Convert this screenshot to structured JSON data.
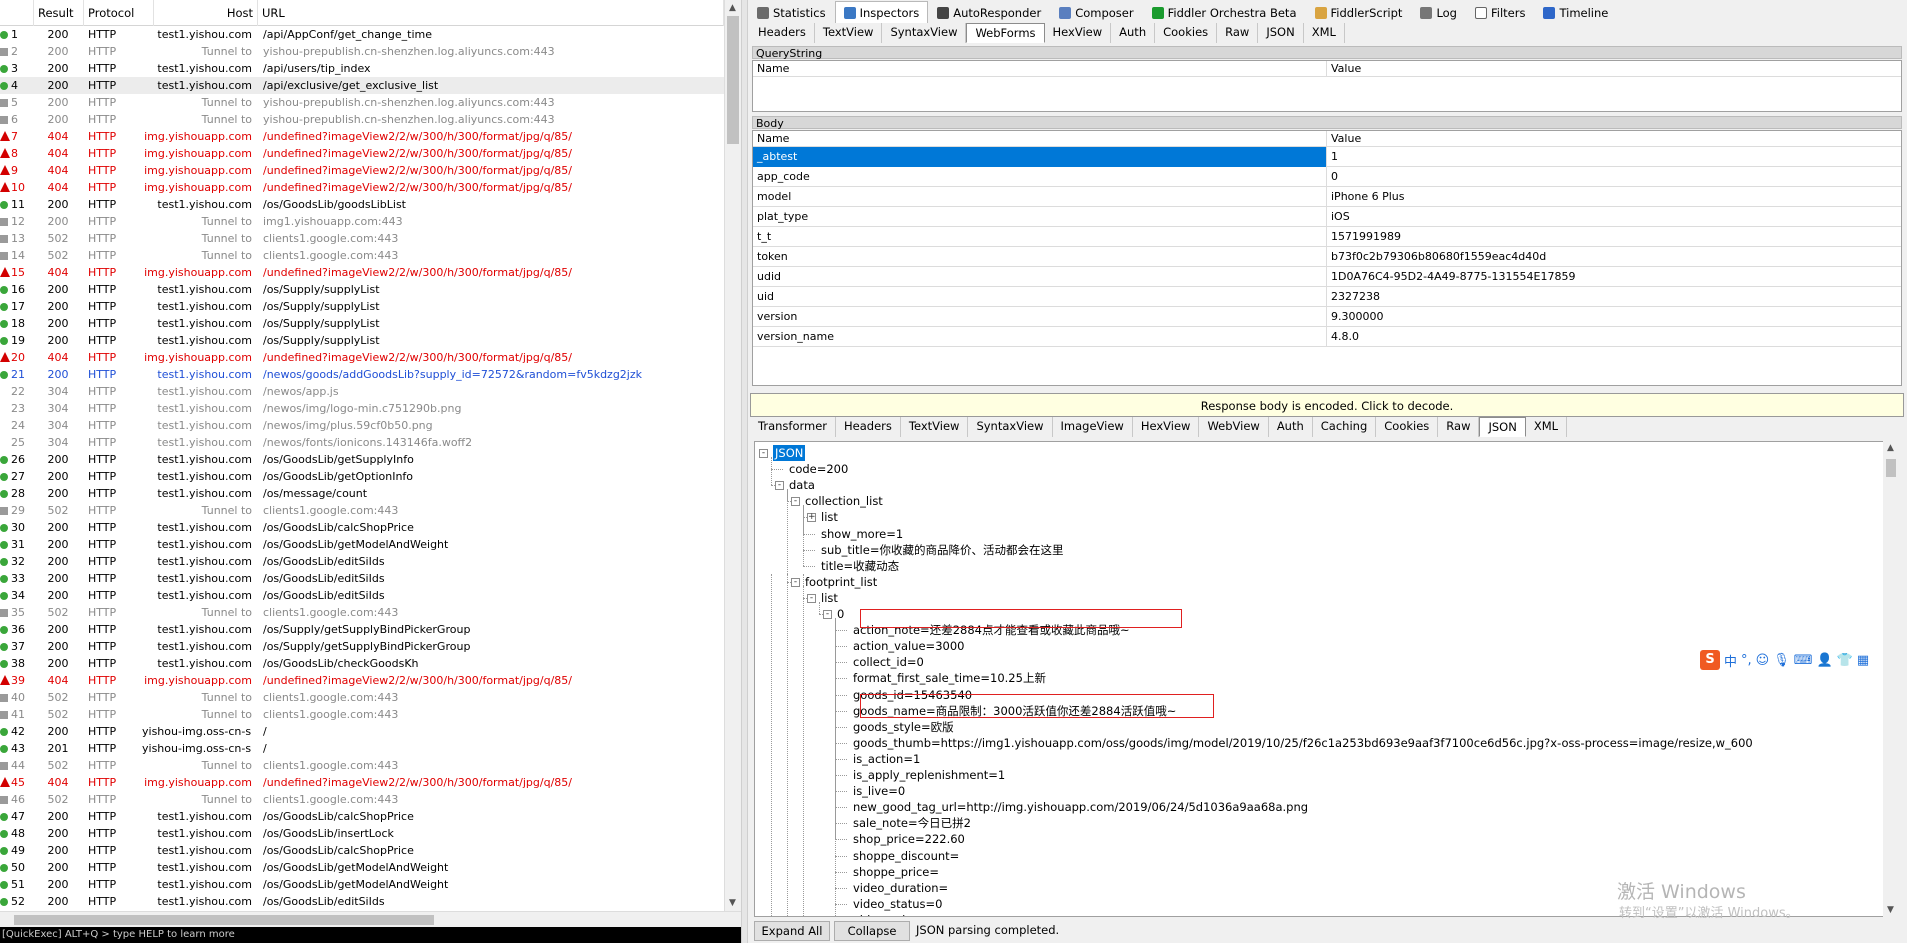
{
  "sessions": {
    "columns": [
      "Result",
      "Protocol",
      "Host",
      "URL"
    ],
    "rows": [
      {
        "num": "1",
        "result": "200",
        "protocol": "HTTP",
        "host": "test1.yishou.com",
        "url": "/api/AppConf/get_change_time",
        "style": "normal",
        "icon": "ok"
      },
      {
        "num": "2",
        "result": "200",
        "protocol": "HTTP",
        "host": "Tunnel to",
        "url": "yishou-prepublish.cn-shenzhen.log.aliyuncs.com:443",
        "style": "gray",
        "icon": "tun"
      },
      {
        "num": "3",
        "result": "200",
        "protocol": "HTTP",
        "host": "test1.yishou.com",
        "url": "/api/users/tip_index",
        "style": "normal",
        "icon": "ok"
      },
      {
        "num": "4",
        "result": "200",
        "protocol": "HTTP",
        "host": "test1.yishou.com",
        "url": "/api/exclusive/get_exclusive_list",
        "style": "normal",
        "icon": "ok",
        "selected": true
      },
      {
        "num": "5",
        "result": "200",
        "protocol": "HTTP",
        "host": "Tunnel to",
        "url": "yishou-prepublish.cn-shenzhen.log.aliyuncs.com:443",
        "style": "gray",
        "icon": "tun"
      },
      {
        "num": "6",
        "result": "200",
        "protocol": "HTTP",
        "host": "Tunnel to",
        "url": "yishou-prepublish.cn-shenzhen.log.aliyuncs.com:443",
        "style": "gray",
        "icon": "tun"
      },
      {
        "num": "7",
        "result": "404",
        "protocol": "HTTP",
        "host": "img.yishouapp.com",
        "url": "/undefined?imageView2/2/w/300/h/300/format/jpg/q/85/",
        "style": "err",
        "icon": "warn"
      },
      {
        "num": "8",
        "result": "404",
        "protocol": "HTTP",
        "host": "img.yishouapp.com",
        "url": "/undefined?imageView2/2/w/300/h/300/format/jpg/q/85/",
        "style": "err",
        "icon": "warn"
      },
      {
        "num": "9",
        "result": "404",
        "protocol": "HTTP",
        "host": "img.yishouapp.com",
        "url": "/undefined?imageView2/2/w/300/h/300/format/jpg/q/85/",
        "style": "err",
        "icon": "warn"
      },
      {
        "num": "10",
        "result": "404",
        "protocol": "HTTP",
        "host": "img.yishouapp.com",
        "url": "/undefined?imageView2/2/w/300/h/300/format/jpg/q/85/",
        "style": "err",
        "icon": "warn"
      },
      {
        "num": "11",
        "result": "200",
        "protocol": "HTTP",
        "host": "test1.yishou.com",
        "url": "/os/GoodsLib/goodsLibList",
        "style": "normal",
        "icon": "ok"
      },
      {
        "num": "12",
        "result": "200",
        "protocol": "HTTP",
        "host": "Tunnel to",
        "url": "img1.yishouapp.com:443",
        "style": "gray",
        "icon": "tun"
      },
      {
        "num": "13",
        "result": "502",
        "protocol": "HTTP",
        "host": "Tunnel to",
        "url": "clients1.google.com:443",
        "style": "gray",
        "icon": "tun"
      },
      {
        "num": "14",
        "result": "502",
        "protocol": "HTTP",
        "host": "Tunnel to",
        "url": "clients1.google.com:443",
        "style": "gray",
        "icon": "tun"
      },
      {
        "num": "15",
        "result": "404",
        "protocol": "HTTP",
        "host": "img.yishouapp.com",
        "url": "/undefined?imageView2/2/w/300/h/300/format/jpg/q/85/",
        "style": "err",
        "icon": "warn"
      },
      {
        "num": "16",
        "result": "200",
        "protocol": "HTTP",
        "host": "test1.yishou.com",
        "url": "/os/Supply/supplyList",
        "style": "normal",
        "icon": "ok"
      },
      {
        "num": "17",
        "result": "200",
        "protocol": "HTTP",
        "host": "test1.yishou.com",
        "url": "/os/Supply/supplyList",
        "style": "normal",
        "icon": "ok"
      },
      {
        "num": "18",
        "result": "200",
        "protocol": "HTTP",
        "host": "test1.yishou.com",
        "url": "/os/Supply/supplyList",
        "style": "normal",
        "icon": "ok"
      },
      {
        "num": "19",
        "result": "200",
        "protocol": "HTTP",
        "host": "test1.yishou.com",
        "url": "/os/Supply/supplyList",
        "style": "normal",
        "icon": "ok"
      },
      {
        "num": "20",
        "result": "404",
        "protocol": "HTTP",
        "host": "img.yishouapp.com",
        "url": "/undefined?imageView2/2/w/300/h/300/format/jpg/q/85/",
        "style": "err",
        "icon": "warn"
      },
      {
        "num": "21",
        "result": "200",
        "protocol": "HTTP",
        "host": "test1.yishou.com",
        "url": "/newos/goods/addGoodsLib?supply_id=72572&random=fv5kdzg2jzk",
        "style": "blue",
        "icon": "ok"
      },
      {
        "num": "22",
        "result": "304",
        "protocol": "HTTP",
        "host": "test1.yishou.com",
        "url": "/newos/app.js",
        "style": "gray",
        "icon": "none"
      },
      {
        "num": "23",
        "result": "304",
        "protocol": "HTTP",
        "host": "test1.yishou.com",
        "url": "/newos/img/logo-min.c751290b.png",
        "style": "gray",
        "icon": "none"
      },
      {
        "num": "24",
        "result": "304",
        "protocol": "HTTP",
        "host": "test1.yishou.com",
        "url": "/newos/img/plus.59cf0b50.png",
        "style": "gray",
        "icon": "none"
      },
      {
        "num": "25",
        "result": "304",
        "protocol": "HTTP",
        "host": "test1.yishou.com",
        "url": "/newos/fonts/ionicons.143146fa.woff2",
        "style": "gray",
        "icon": "none"
      },
      {
        "num": "26",
        "result": "200",
        "protocol": "HTTP",
        "host": "test1.yishou.com",
        "url": "/os/GoodsLib/getSupplyInfo",
        "style": "normal",
        "icon": "ok"
      },
      {
        "num": "27",
        "result": "200",
        "protocol": "HTTP",
        "host": "test1.yishou.com",
        "url": "/os/GoodsLib/getOptionInfo",
        "style": "normal",
        "icon": "ok"
      },
      {
        "num": "28",
        "result": "200",
        "protocol": "HTTP",
        "host": "test1.yishou.com",
        "url": "/os/message/count",
        "style": "normal",
        "icon": "ok"
      },
      {
        "num": "29",
        "result": "502",
        "protocol": "HTTP",
        "host": "Tunnel to",
        "url": "clients1.google.com:443",
        "style": "gray",
        "icon": "tun"
      },
      {
        "num": "30",
        "result": "200",
        "protocol": "HTTP",
        "host": "test1.yishou.com",
        "url": "/os/GoodsLib/calcShopPrice",
        "style": "normal",
        "icon": "ok"
      },
      {
        "num": "31",
        "result": "200",
        "protocol": "HTTP",
        "host": "test1.yishou.com",
        "url": "/os/GoodsLib/getModelAndWeight",
        "style": "normal",
        "icon": "ok"
      },
      {
        "num": "32",
        "result": "200",
        "protocol": "HTTP",
        "host": "test1.yishou.com",
        "url": "/os/GoodsLib/editSiIds",
        "style": "normal",
        "icon": "ok"
      },
      {
        "num": "33",
        "result": "200",
        "protocol": "HTTP",
        "host": "test1.yishou.com",
        "url": "/os/GoodsLib/editSiIds",
        "style": "normal",
        "icon": "ok"
      },
      {
        "num": "34",
        "result": "200",
        "protocol": "HTTP",
        "host": "test1.yishou.com",
        "url": "/os/GoodsLib/editSiIds",
        "style": "normal",
        "icon": "ok"
      },
      {
        "num": "35",
        "result": "502",
        "protocol": "HTTP",
        "host": "Tunnel to",
        "url": "clients1.google.com:443",
        "style": "gray",
        "icon": "tun"
      },
      {
        "num": "36",
        "result": "200",
        "protocol": "HTTP",
        "host": "test1.yishou.com",
        "url": "/os/Supply/getSupplyBindPickerGroup",
        "style": "normal",
        "icon": "ok"
      },
      {
        "num": "37",
        "result": "200",
        "protocol": "HTTP",
        "host": "test1.yishou.com",
        "url": "/os/Supply/getSupplyBindPickerGroup",
        "style": "normal",
        "icon": "ok"
      },
      {
        "num": "38",
        "result": "200",
        "protocol": "HTTP",
        "host": "test1.yishou.com",
        "url": "/os/GoodsLib/checkGoodsKh",
        "style": "normal",
        "icon": "ok"
      },
      {
        "num": "39",
        "result": "404",
        "protocol": "HTTP",
        "host": "img.yishouapp.com",
        "url": "/undefined?imageView2/2/w/300/h/300/format/jpg/q/85/",
        "style": "err",
        "icon": "warn"
      },
      {
        "num": "40",
        "result": "502",
        "protocol": "HTTP",
        "host": "Tunnel to",
        "url": "clients1.google.com:443",
        "style": "gray",
        "icon": "tun"
      },
      {
        "num": "41",
        "result": "502",
        "protocol": "HTTP",
        "host": "Tunnel to",
        "url": "clients1.google.com:443",
        "style": "gray",
        "icon": "tun"
      },
      {
        "num": "42",
        "result": "200",
        "protocol": "HTTP",
        "host": "yishou-img.oss-cn-s...",
        "url": "/",
        "style": "normal",
        "icon": "ok"
      },
      {
        "num": "43",
        "result": "201",
        "protocol": "HTTP",
        "host": "yishou-img.oss-cn-s...",
        "url": "/",
        "style": "normal",
        "icon": "ok"
      },
      {
        "num": "44",
        "result": "502",
        "protocol": "HTTP",
        "host": "Tunnel to",
        "url": "clients1.google.com:443",
        "style": "gray",
        "icon": "tun"
      },
      {
        "num": "45",
        "result": "404",
        "protocol": "HTTP",
        "host": "img.yishouapp.com",
        "url": "/undefined?imageView2/2/w/300/h/300/format/jpg/q/85/",
        "style": "err",
        "icon": "warn"
      },
      {
        "num": "46",
        "result": "502",
        "protocol": "HTTP",
        "host": "Tunnel to",
        "url": "clients1.google.com:443",
        "style": "gray",
        "icon": "tun"
      },
      {
        "num": "47",
        "result": "200",
        "protocol": "HTTP",
        "host": "test1.yishou.com",
        "url": "/os/GoodsLib/calcShopPrice",
        "style": "normal",
        "icon": "ok"
      },
      {
        "num": "48",
        "result": "200",
        "protocol": "HTTP",
        "host": "test1.yishou.com",
        "url": "/os/GoodsLib/insertLock",
        "style": "normal",
        "icon": "ok"
      },
      {
        "num": "49",
        "result": "200",
        "protocol": "HTTP",
        "host": "test1.yishou.com",
        "url": "/os/GoodsLib/calcShopPrice",
        "style": "normal",
        "icon": "ok"
      },
      {
        "num": "50",
        "result": "200",
        "protocol": "HTTP",
        "host": "test1.yishou.com",
        "url": "/os/GoodsLib/getModelAndWeight",
        "style": "normal",
        "icon": "ok"
      },
      {
        "num": "51",
        "result": "200",
        "protocol": "HTTP",
        "host": "test1.yishou.com",
        "url": "/os/GoodsLib/getModelAndWeight",
        "style": "normal",
        "icon": "ok"
      },
      {
        "num": "52",
        "result": "200",
        "protocol": "HTTP",
        "host": "test1.yishou.com",
        "url": "/os/GoodsLib/editSiIds",
        "style": "normal",
        "icon": "ok"
      }
    ],
    "quickexec": "[QuickExec] ALT+Q > type HELP to learn more"
  },
  "top_tabs": [
    {
      "label": "Statistics",
      "icon": "stopwatch-icon",
      "color": "#6b6b6b"
    },
    {
      "label": "Inspectors",
      "icon": "magnifier-icon",
      "color": "#3b78c4",
      "active": true
    },
    {
      "label": "AutoResponder",
      "icon": "lightning-icon",
      "color": "#444444"
    },
    {
      "label": "Composer",
      "icon": "edit-icon",
      "color": "#5a7fbf"
    },
    {
      "label": "Fiddler Orchestra Beta",
      "icon": "fo-icon",
      "color": "#1a9b2e"
    },
    {
      "label": "FiddlerScript",
      "icon": "script-icon",
      "color": "#d9a441"
    },
    {
      "label": "Log",
      "icon": "log-icon",
      "color": "#777777"
    },
    {
      "label": "Filters",
      "icon": "checkbox-icon",
      "color": "#ffffff"
    },
    {
      "label": "Timeline",
      "icon": "timeline-icon",
      "color": "#2e67c9"
    }
  ],
  "request_tabs": [
    {
      "label": "Headers"
    },
    {
      "label": "TextView"
    },
    {
      "label": "SyntaxView"
    },
    {
      "label": "WebForms",
      "active": true
    },
    {
      "label": "HexView"
    },
    {
      "label": "Auth"
    },
    {
      "label": "Cookies"
    },
    {
      "label": "Raw"
    },
    {
      "label": "JSON"
    },
    {
      "label": "XML"
    }
  ],
  "querystring": {
    "title": "QueryString",
    "col_name": "Name",
    "col_value": "Value"
  },
  "body": {
    "title": "Body",
    "col_name": "Name",
    "col_value": "Value",
    "rows": [
      {
        "name": "_abtest",
        "value": "1",
        "selected": true
      },
      {
        "name": "app_code",
        "value": "0"
      },
      {
        "name": "model",
        "value": "iPhone 6 Plus"
      },
      {
        "name": "plat_type",
        "value": "iOS"
      },
      {
        "name": "t_t",
        "value": "1571991989"
      },
      {
        "name": "token",
        "value": "b73f0c2b79306b80680f1559eac4d40d"
      },
      {
        "name": "udid",
        "value": "1D0A76C4-95D2-4A49-8775-131554E17859"
      },
      {
        "name": "uid",
        "value": "2327238"
      },
      {
        "name": "version",
        "value": "9.300000"
      },
      {
        "name": "version_name",
        "value": "4.8.0"
      }
    ]
  },
  "encoded_notice": "Response body is encoded. Click to decode.",
  "response_tabs": [
    {
      "label": "Transformer"
    },
    {
      "label": "Headers"
    },
    {
      "label": "TextView"
    },
    {
      "label": "SyntaxView"
    },
    {
      "label": "ImageView"
    },
    {
      "label": "HexView"
    },
    {
      "label": "WebView"
    },
    {
      "label": "Auth"
    },
    {
      "label": "Caching"
    },
    {
      "label": "Cookies"
    },
    {
      "label": "Raw"
    },
    {
      "label": "JSON",
      "active": true
    },
    {
      "label": "XML"
    }
  ],
  "json_tree": [
    {
      "depth": 0,
      "text": "JSON",
      "box": "-",
      "selected": true
    },
    {
      "depth": 1,
      "text": "code=200"
    },
    {
      "depth": 1,
      "text": "data",
      "box": "-"
    },
    {
      "depth": 2,
      "text": "collection_list",
      "box": "-"
    },
    {
      "depth": 3,
      "text": "list",
      "box": "+"
    },
    {
      "depth": 3,
      "text": "show_more=1"
    },
    {
      "depth": 3,
      "text": "sub_title=你收藏的商品降价、活动都会在这里"
    },
    {
      "depth": 3,
      "text": "title=收藏动态"
    },
    {
      "depth": 2,
      "text": "footprint_list",
      "box": "-"
    },
    {
      "depth": 3,
      "text": "list",
      "box": "-"
    },
    {
      "depth": 4,
      "text": "0",
      "box": "-"
    },
    {
      "depth": 5,
      "text": "action_note=还差2884点才能查看或收藏此商品哦~"
    },
    {
      "depth": 5,
      "text": "action_value=3000"
    },
    {
      "depth": 5,
      "text": "collect_id=0"
    },
    {
      "depth": 5,
      "text": "format_first_sale_time=10.25上新"
    },
    {
      "depth": 5,
      "text": "goods_id=15463540"
    },
    {
      "depth": 5,
      "text": "goods_name=商品限制：3000活跃值你还差2884活跃值哦~"
    },
    {
      "depth": 5,
      "text": "goods_style=欧版"
    },
    {
      "depth": 5,
      "text": "goods_thumb=https://img1.yishouapp.com/oss/goods/img/model/2019/10/25/f26c1a253bd693e9aaf3f7100ce6d56c.jpg?x-oss-process=image/resize,w_600"
    },
    {
      "depth": 5,
      "text": "is_action=1"
    },
    {
      "depth": 5,
      "text": "is_apply_replenishment=1"
    },
    {
      "depth": 5,
      "text": "is_live=0"
    },
    {
      "depth": 5,
      "text": "new_good_tag_url=http://img.yishouapp.com/2019/06/24/5d1036a9aa68a.png"
    },
    {
      "depth": 5,
      "text": "sale_note=今日已拼2"
    },
    {
      "depth": 5,
      "text": "shop_price=222.60"
    },
    {
      "depth": 5,
      "text": "shoppe_discount="
    },
    {
      "depth": 5,
      "text": "shoppe_price="
    },
    {
      "depth": 5,
      "text": "video_duration="
    },
    {
      "depth": 5,
      "text": "video_status=0"
    },
    {
      "depth": 5,
      "text": "video_url="
    }
  ],
  "bottom": {
    "expand_all": "Expand All",
    "collapse": "Collapse",
    "status": "JSON parsing completed."
  },
  "watermark": {
    "line1": "激活 Windows",
    "line2": "转到“设置”以激活 Windows。"
  },
  "ime": {
    "logo": "S",
    "lang": "中",
    "punct": "°,"
  },
  "colors": {
    "error": "#e00000",
    "tunnel": "#8a8a8a",
    "link": "#1f4fd6",
    "selection": "#0078d7",
    "notice_bg": "#ffffe1",
    "highlight_box": "#e02020"
  }
}
